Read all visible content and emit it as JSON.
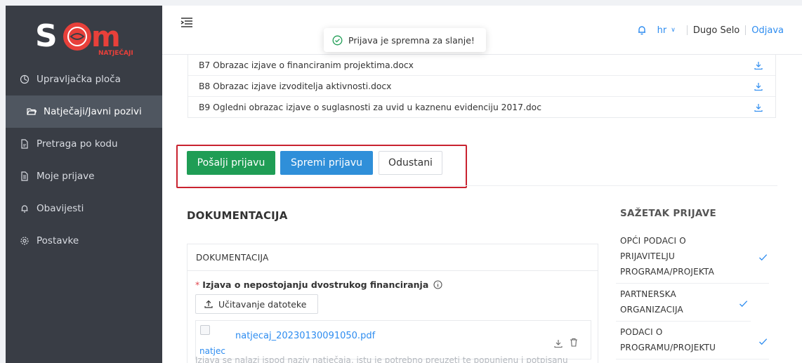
{
  "brand": {
    "logo_text": "SOM",
    "logo_sub": "NATJEČAJI"
  },
  "sidebar": {
    "items": [
      {
        "label": "Upravljačka ploča",
        "icon": "dashboard-icon"
      },
      {
        "label": "Natječaji/Javni pozivi",
        "icon": "folder-open-icon",
        "active": true
      },
      {
        "label": "Pretraga po kodu",
        "icon": "file-search-icon"
      },
      {
        "label": "Moje prijave",
        "icon": "file-text-icon"
      },
      {
        "label": "Obavijesti",
        "icon": "bell-icon"
      },
      {
        "label": "Postavke",
        "icon": "gear-icon"
      }
    ]
  },
  "header": {
    "language": "hr",
    "city": "Dugo Selo",
    "logout": "Odjava"
  },
  "toast": {
    "message": "Prijava je spremna za slanje!"
  },
  "files": [
    "B7 Obrazac izjave o financiranim projektima.docx",
    "B8 Obrazac izjave izvoditelja aktivnosti.docx",
    "B9 Ogledni obrazac izjave o suglasnosti za uvid u kaznenu evidenciju 2017.doc"
  ],
  "actions": {
    "send": "Pošalji prijavu",
    "save": "Spremi prijavu",
    "cancel": "Odustani"
  },
  "documentation": {
    "section_title": "DOKUMENTACIJA",
    "card_title": "DOKUMENTACIJA",
    "required_label": "Izjava o nepostojanju dvostrukog financiranja",
    "upload_label": "Učitavanje datoteke",
    "uploaded_file": "natjecaj_20230130091050.pdf",
    "thumb_alt": "natjec",
    "note": "Izjava se nalazi ispod naziv natječaja, istu je potrebno preuzeti te popunjenu i potpisanu"
  },
  "summary": {
    "title": "SAŽETAK PRIJAVE",
    "items": [
      {
        "lines": [
          "OPĆI PODACI O",
          "PRIJAVITELJU",
          "PROGRAMA/PROJEKTA"
        ],
        "done": true
      },
      {
        "lines": [
          "PARTNERSKA",
          "ORGANIZACIJA"
        ],
        "done": true
      },
      {
        "lines": [
          "PODACI O",
          "PROGRAMU/PROJEKTU"
        ],
        "done": true
      }
    ]
  },
  "colors": {
    "sidebar_bg": "#393d45",
    "accent_blue": "#2f8fd9",
    "success_green": "#1f9d55",
    "highlight_red": "#c9232f",
    "logo_red": "#e8403a"
  }
}
